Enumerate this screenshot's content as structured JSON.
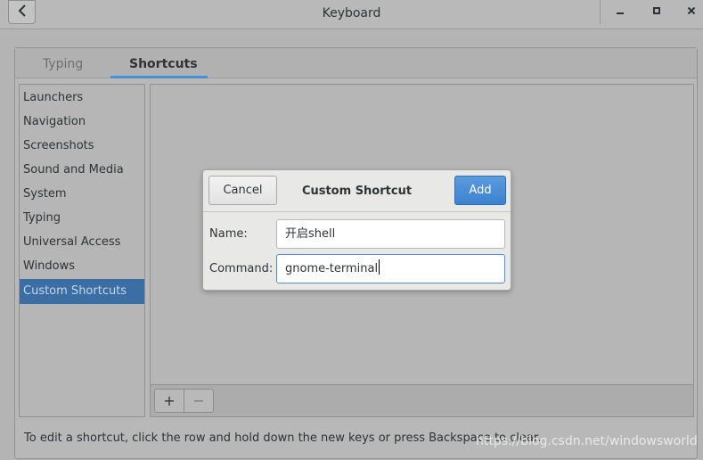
{
  "window": {
    "title": "Keyboard",
    "back_icon": "chevron-left-icon",
    "controls": [
      "minimize-icon",
      "maximize-icon",
      "close-icon"
    ]
  },
  "tabs": [
    {
      "label": "Typing",
      "active": false
    },
    {
      "label": "Shortcuts",
      "active": true
    }
  ],
  "categories": [
    {
      "label": "Launchers",
      "selected": false
    },
    {
      "label": "Navigation",
      "selected": false
    },
    {
      "label": "Screenshots",
      "selected": false
    },
    {
      "label": "Sound and Media",
      "selected": false
    },
    {
      "label": "System",
      "selected": false
    },
    {
      "label": "Typing",
      "selected": false
    },
    {
      "label": "Universal Access",
      "selected": false
    },
    {
      "label": "Windows",
      "selected": false
    },
    {
      "label": "Custom Shortcuts",
      "selected": true
    }
  ],
  "toolbar": {
    "add_label": "+",
    "remove_label": "−"
  },
  "hint": "To edit a shortcut, click the row and hold down the new keys or press Backspace to clear.",
  "watermark": "https://blog.csdn.net/windowsworld",
  "dialog": {
    "title": "Custom Shortcut",
    "cancel_label": "Cancel",
    "add_label": "Add",
    "name_label": "Name:",
    "name_value": "开启shell",
    "command_label": "Command:",
    "command_value": "gnome-terminal"
  },
  "colors": {
    "accent": "#4a90d9",
    "selection": "#3a6ea5",
    "add_button": "#3c82d0"
  }
}
